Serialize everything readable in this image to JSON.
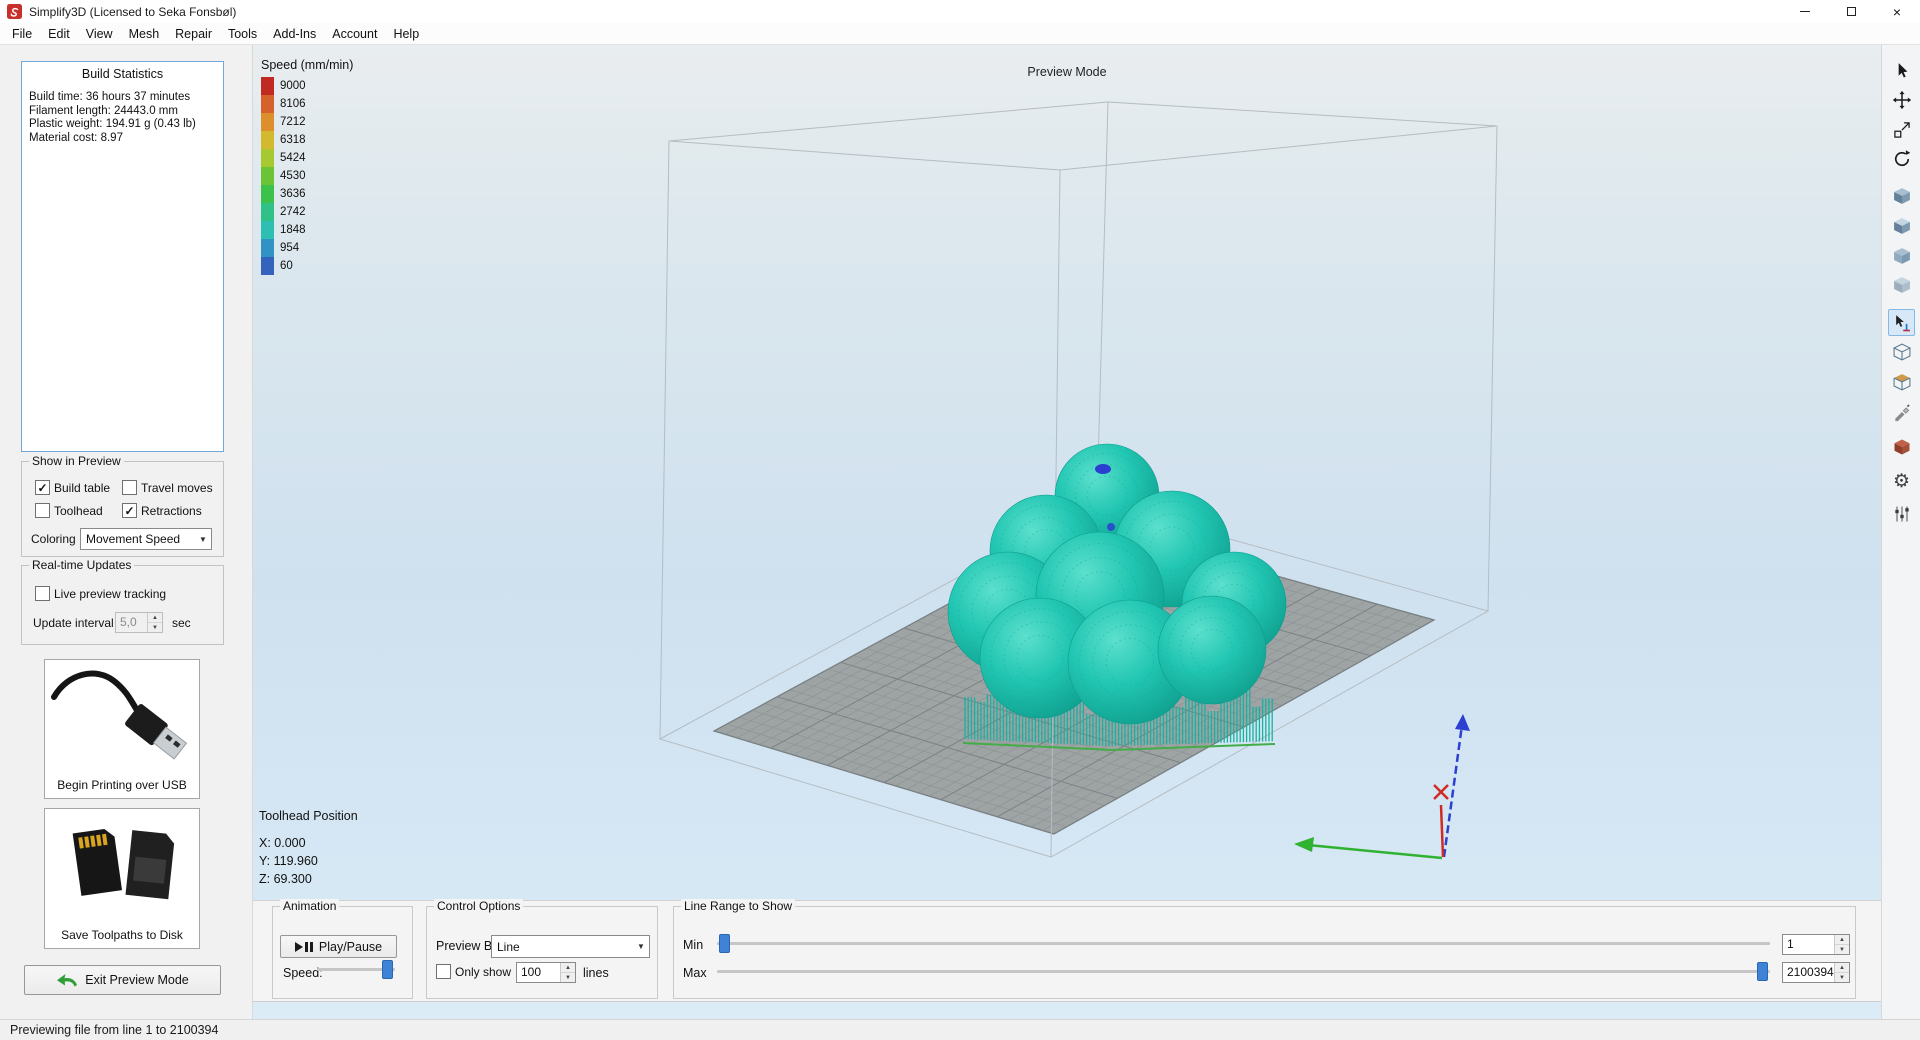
{
  "window": {
    "title": "Simplify3D (Licensed to Seka Fonsbøl)"
  },
  "icons": {
    "close": "×",
    "minimize": "—",
    "maximize": "□",
    "dropdown_arrow": "▼",
    "spin_up": "▲",
    "spin_down": "▼",
    "check": "✓",
    "play": "▶",
    "pause": "❚❚",
    "gear": "⚙"
  },
  "menu": {
    "items": [
      "File",
      "Edit",
      "View",
      "Mesh",
      "Repair",
      "Tools",
      "Add-Ins",
      "Account",
      "Help"
    ]
  },
  "sidebar": {
    "build_statistics": {
      "title": "Build Statistics",
      "lines": [
        "Build time: 36 hours 37 minutes",
        "Filament length: 24443.0 mm",
        "Plastic weight: 194.91 g (0.43 lb)",
        "Material cost: 8.97"
      ]
    },
    "show_in_preview": {
      "title": "Show in Preview",
      "options": [
        {
          "label": "Build table",
          "checked": true
        },
        {
          "label": "Travel moves",
          "checked": false
        },
        {
          "label": "Toolhead",
          "checked": false
        },
        {
          "label": "Retractions",
          "checked": true
        }
      ],
      "coloring_label": "Coloring",
      "coloring_value": "Movement Speed"
    },
    "realtime_updates": {
      "title": "Real-time Updates",
      "live_preview": {
        "label": "Live preview tracking",
        "checked": false
      },
      "update_interval_label": "Update interval",
      "update_interval_value": "5,0",
      "update_interval_unit": "sec"
    },
    "usb_button_label": "Begin Printing over USB",
    "disk_button_label": "Save Toolpaths to Disk",
    "exit_button_label": "Exit Preview Mode"
  },
  "viewport": {
    "mode_label": "Preview Mode",
    "speed_legend": {
      "title": "Speed (mm/min)",
      "entries": [
        {
          "value": "9000",
          "color": "#c02a23"
        },
        {
          "value": "8106",
          "color": "#d4622a"
        },
        {
          "value": "7212",
          "color": "#dd8f2c"
        },
        {
          "value": "6318",
          "color": "#d2b92e"
        },
        {
          "value": "5424",
          "color": "#a6c831"
        },
        {
          "value": "4530",
          "color": "#6ac436"
        },
        {
          "value": "3636",
          "color": "#3cc14b"
        },
        {
          "value": "2742",
          "color": "#2fc187"
        },
        {
          "value": "1848",
          "color": "#2dbfb2"
        },
        {
          "value": "954",
          "color": "#3093c4"
        },
        {
          "value": "60",
          "color": "#3463be"
        }
      ]
    },
    "toolhead_position": {
      "title": "Toolhead Position",
      "x": "X: 0.000",
      "y": "Y: 119.960",
      "z": "Z: 69.300"
    },
    "model_color": "#1fc4b0"
  },
  "controls": {
    "animation": {
      "title": "Animation",
      "play_pause_label": "Play/Pause",
      "speed_label": "Speed:"
    },
    "control_options": {
      "title": "Control Options",
      "preview_by_label": "Preview By",
      "preview_by_value": "Line",
      "only_show": {
        "label": "Only show",
        "checked": false
      },
      "only_show_value": "100",
      "lines_label": "lines"
    },
    "line_range": {
      "title": "Line Range to Show",
      "min_label": "Min",
      "min_value": "1",
      "max_label": "Max",
      "max_value": "2100394"
    }
  },
  "toolbar": {
    "tools": [
      "select-tool",
      "move-tool",
      "scale-tool",
      "rotate-tool",
      "view-isometric",
      "view-top",
      "view-front",
      "view-side",
      "pointer-position-tool",
      "wireframe-view",
      "cross-section-view",
      "nozzle-tool",
      "support-tool",
      "settings",
      "machine-control"
    ],
    "selected_tool": "pointer-position-tool"
  },
  "status_bar": {
    "text": "Previewing file from line 1 to 2100394"
  }
}
